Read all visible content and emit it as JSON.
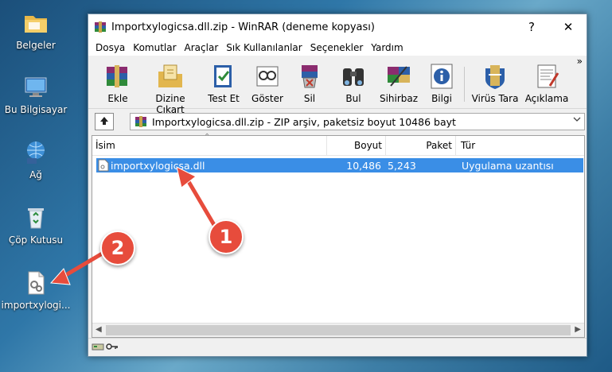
{
  "desktop": {
    "icons": [
      {
        "label": "Belgeler",
        "icon": "folder-icon"
      },
      {
        "label": "Bu Bilgisayar",
        "icon": "computer-icon"
      },
      {
        "label": "Ağ",
        "icon": "network-icon"
      },
      {
        "label": "Çöp Kutusu",
        "icon": "recycle-bin-icon"
      },
      {
        "label": "importxylogi...",
        "icon": "dll-file-icon"
      }
    ]
  },
  "window": {
    "title": "Importxylogicsa.dll.zip - WinRAR (deneme kopyası)",
    "help_label": "?",
    "close_label": "✕"
  },
  "menu": [
    "Dosya",
    "Komutlar",
    "Araçlar",
    "Sık Kullanılanlar",
    "Seçenekler",
    "Yardım"
  ],
  "toolbar": {
    "buttons": [
      {
        "label": "Ekle",
        "icon": "add-archive-icon"
      },
      {
        "label": "Dizine Çıkart",
        "icon": "extract-icon"
      },
      {
        "label": "Test Et",
        "icon": "test-icon"
      },
      {
        "label": "Göster",
        "icon": "view-icon"
      },
      {
        "label": "Sil",
        "icon": "delete-icon"
      },
      {
        "label": "Bul",
        "icon": "find-icon"
      },
      {
        "label": "Sihirbaz",
        "icon": "wizard-icon"
      },
      {
        "label": "Bilgi",
        "icon": "info-icon"
      },
      {
        "label": "Virüs Tara",
        "icon": "virus-scan-icon"
      },
      {
        "label": "Açıklama",
        "icon": "comment-icon"
      }
    ],
    "more": "»"
  },
  "address": {
    "text": "Importxylogicsa.dll.zip - ZIP arşiv, paketsiz boyut 10486 bayt"
  },
  "columns": {
    "name": "İsim",
    "size": "Boyut",
    "packed": "Paket",
    "type": "Tür"
  },
  "files": [
    {
      "name": "importxylogicsa.dll",
      "size": "10,486",
      "packed": "5,243",
      "type": "Uygulama uzantısı"
    }
  ],
  "annotations": {
    "badge1": "1",
    "badge2": "2"
  },
  "colors": {
    "selection": "#3a8ee6",
    "badge": "#e74c3c"
  }
}
